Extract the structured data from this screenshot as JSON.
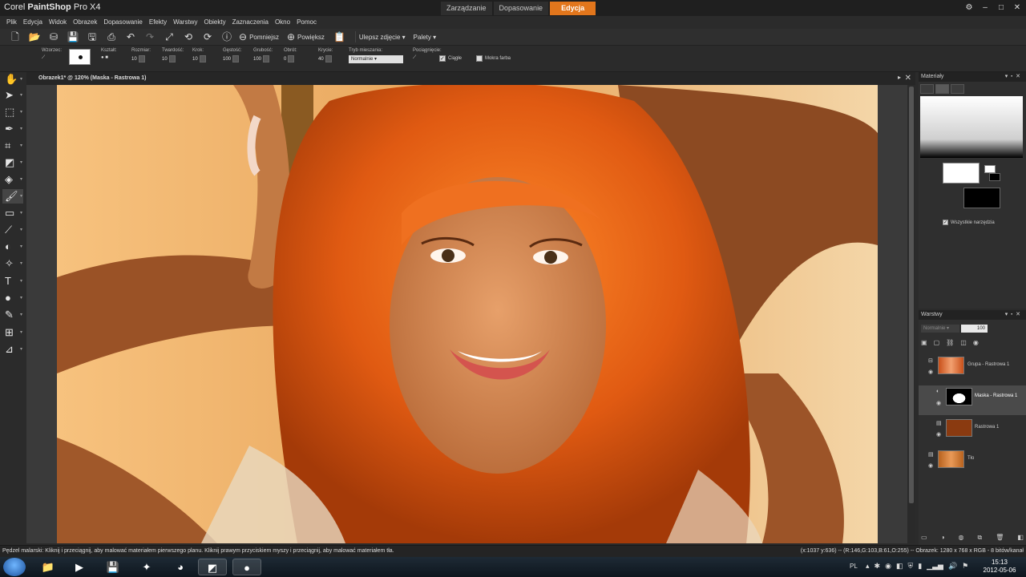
{
  "app": {
    "title_prefix": "Corel",
    "title_brand": "PaintShop",
    "title_suffix": "Pro X4"
  },
  "workspace_tabs": [
    {
      "label": "Zarządzanie",
      "active": false
    },
    {
      "label": "Dopasowanie",
      "active": false
    },
    {
      "label": "Edycja",
      "active": true
    }
  ],
  "menu": [
    "Plik",
    "Edycja",
    "Widok",
    "Obrazek",
    "Dopasowanie",
    "Efekty",
    "Warstwy",
    "Obiekty",
    "Zaznaczenia",
    "Okno",
    "Pomoc"
  ],
  "toolbar": {
    "zoom_out_label": "Pomniejsz",
    "zoom_in_label": "Powiększ",
    "enhance_label": "Ulepsz zdjęcie",
    "palettes_label": "Palety"
  },
  "tool_options": {
    "presets_label": "Wzorzec:",
    "shape_label": "Kształt:",
    "size_label": "Rozmiar:",
    "size_value": "10",
    "hardness_label": "Twardość:",
    "hardness_value": "10",
    "step_label": "Krok:",
    "step_value": "10",
    "density_label": "Gęstość:",
    "density_value": "100",
    "thickness_label": "Grubość:",
    "thickness_value": "100",
    "rotation_label": "Obrót:",
    "rotation_value": "0",
    "opacity_label": "Krycie:",
    "opacity_value": "40",
    "blend_label": "Tryb mieszania:",
    "blend_value": "Normalnie",
    "stroke_label": "Pociągnięcie:",
    "continuous_label": "Ciągłe",
    "wet_label": "Mokra farba"
  },
  "document": {
    "title": "Obrazek1* @ 120% (Maska - Rastrowa 1)"
  },
  "materials": {
    "title": "Materiały",
    "all_tools_label": "Wszystkie narzędzia"
  },
  "layers": {
    "title": "Warstwy",
    "blend_value": "Normalnie",
    "opacity_value": "100",
    "items": [
      {
        "name": "Grupa - Rastrowa 1"
      },
      {
        "name": "Maska - Rastrowa 1"
      },
      {
        "name": "Rastrowa 1"
      },
      {
        "name": "Tło"
      }
    ]
  },
  "status": {
    "left": "Pędzel malarski: Kliknij i przeciągnij, aby malować materiałem pierwszego planu. Kliknij prawym przyciskiem myszy i przeciągnij, aby malować materiałem tła.",
    "right": "(x:1037 y:636) -- (R:146,G:103,B:61,O:255) -- Obrazek: 1280 x 768 x RGB - 8 bitów/kanał"
  },
  "taskbar": {
    "lang": "PL",
    "time": "15:13",
    "date": "2012-05-06"
  },
  "colors": {
    "accent": "#e2761c",
    "layer_fill": "#8a3a10"
  }
}
